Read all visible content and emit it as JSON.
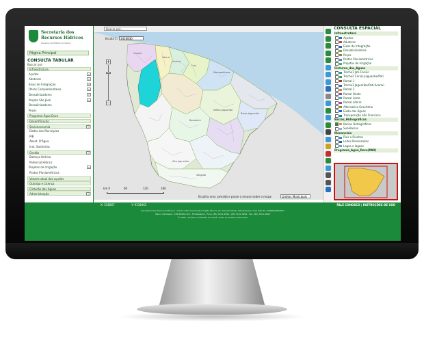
{
  "brand": {
    "line1": "Secretaria dos",
    "line2": "Recursos Hídricos",
    "line3": "Governo do Estado do Ceará"
  },
  "colors": {
    "accent": "#1c8a3b",
    "dark_green": "#124a20",
    "highlight_basin": "#1fd4d8",
    "selected_box": "#cc1111"
  },
  "left_panel": {
    "main_page": "Página Principal",
    "title": "CONSULTA TABULAR",
    "search_label": "Buscar por:",
    "rows": [
      {
        "label": "Infraestrutura",
        "type": "header"
      },
      {
        "label": "Açudes",
        "type": "dropdown"
      },
      {
        "label": "Adutoras",
        "type": "dropdown"
      },
      {
        "label": "Eixos de Integração",
        "type": "dropdown"
      },
      {
        "label": "Obras Complementares",
        "type": "dropdown"
      },
      {
        "label": "Dessalinizadores",
        "type": "dropdown"
      },
      {
        "label": "Projeto São José",
        "type": "dropdown"
      },
      {
        "label": "Dessalinizadores",
        "type": "plain"
      },
      {
        "label": "Poços",
        "type": "plain"
      },
      {
        "label": "Programa Água Doce",
        "type": "header"
      },
      {
        "label": "Desertificação",
        "type": "header"
      },
      {
        "label": "Socioeconomia",
        "type": "header-dd"
      },
      {
        "label": "Dados dos Municípios",
        "type": "sub"
      },
      {
        "label": "PIB",
        "type": "sub"
      },
      {
        "label": "Abast. D'Água",
        "type": "sub"
      },
      {
        "label": "Inst. Sanitárias",
        "type": "sub"
      },
      {
        "label": "Gestão",
        "type": "header-dd"
      },
      {
        "label": "Balanço Hídrico",
        "type": "sub"
      },
      {
        "label": "Potencial Hídrico",
        "type": "sub"
      },
      {
        "label": "Projetos de Irrigação",
        "type": "dropdown"
      },
      {
        "label": "Postos Pluviométricos",
        "type": "sub"
      },
      {
        "label": "Volume atual dos açudes",
        "type": "header"
      },
      {
        "label": "Outorga e Licença",
        "type": "header"
      },
      {
        "label": "Cinturão das Águas",
        "type": "header"
      },
      {
        "label": "Administração",
        "type": "header-dd"
      }
    ]
  },
  "toolbar": {
    "search_placeholder": "Buscar por..."
  },
  "map": {
    "scale_label": "Escala 1:",
    "scale_value": "3426830",
    "scale_bar": [
      "km 0",
      "60",
      "120",
      "180"
    ],
    "hint": "Escolha uma camada e passe o mouse sobre o mapa:",
    "layer_select": "Limites Municipais",
    "region_labels": [
      "Coreaú",
      "Litoral",
      "Acaraú",
      "Curu",
      "Metropolitana",
      "Banabuiú",
      "Médio Jaguaribe",
      "Baixo Jaguaribe",
      "Alto Jaguaribe",
      "Salgado"
    ]
  },
  "right_panel": {
    "title": "CONSULTA ESPACIAL",
    "sections": [
      {
        "title": "Infraestrutura",
        "items": [
          {
            "label": "Açudes",
            "checked": false,
            "swatch": "#2266cc"
          },
          {
            "label": "Adutoras",
            "checked": false,
            "swatch": "#cc4444"
          },
          {
            "label": "Eixos de Integração",
            "checked": false,
            "swatch": "#3355cc"
          },
          {
            "label": "Dessalinizadores",
            "checked": false,
            "swatch": "#66aa44"
          },
          {
            "label": "Poços",
            "checked": false,
            "swatch": "#aa7733"
          },
          {
            "label": "Postos Pluviométricos",
            "checked": false,
            "swatch": "#4488cc"
          },
          {
            "label": "Projetos de Irrigação",
            "checked": false,
            "swatch": "#44aa66"
          }
        ]
      },
      {
        "title": "Cinturao_das_Aguas",
        "items": [
          {
            "label": "Trecho1 Jati-Cariús",
            "checked": false,
            "swatch": "#2299aa"
          },
          {
            "label": "Trecho2 Cariús-Jaguaribe/Poti",
            "checked": false,
            "swatch": "#33aa55"
          },
          {
            "label": "Ramal 1",
            "checked": false,
            "swatch": "#aa3333"
          },
          {
            "label": "Trecho3 Jaguaribe/Poti-Acaraú",
            "checked": false,
            "swatch": "#3366aa"
          },
          {
            "label": "Ramal 2",
            "checked": false,
            "swatch": "#cc8833"
          },
          {
            "label": "Ramal Oeste",
            "checked": false,
            "swatch": "#8844aa"
          },
          {
            "label": "Ramal Leste",
            "checked": false,
            "swatch": "#44aacc"
          },
          {
            "label": "Ramal Litoral",
            "checked": false,
            "swatch": "#aa4488"
          },
          {
            "label": "Alternativa Gravitária",
            "checked": false,
            "swatch": "#888844"
          },
          {
            "label": "Eixão das Águas",
            "checked": false,
            "swatch": "#2266cc"
          },
          {
            "label": "Transposição São Francisco",
            "checked": false,
            "swatch": "#1188bb"
          }
        ]
      },
      {
        "title": "Bacias_Hidrograficas",
        "items": [
          {
            "label": "Bacias Hidrográficas",
            "checked": true,
            "swatch": "#cc9966"
          },
          {
            "label": "Sub-Bacias",
            "checked": false,
            "swatch": "#99aacc"
          }
        ]
      },
      {
        "title": "Mananciais",
        "items": [
          {
            "label": "Rios e Riachos",
            "checked": false,
            "swatch": "#3388dd"
          },
          {
            "label": "Leitos Perenizados",
            "checked": false,
            "swatch": "#2266aa"
          },
          {
            "label": "Lagos e lagoas",
            "checked": false,
            "swatch": "#55aadd"
          }
        ]
      },
      {
        "title": "Programa_Agua_Doce(PAD)",
        "items": []
      }
    ]
  },
  "tools": [
    "zoom-in-icon",
    "pan-left-icon",
    "pan-right-icon",
    "arrow-up-icon",
    "arrow-down-icon",
    "full-extent-icon",
    "zoom-out-icon",
    "identify-icon",
    "info-icon",
    "measure-icon",
    "move-icon",
    "refresh-icon",
    "select-icon",
    "layers-icon",
    "table-icon",
    "draw-icon",
    "pencil-icon",
    "flag-icon",
    "buffer-icon",
    "globe-icon",
    "print-icon",
    "print-alt-icon",
    "help-icon"
  ],
  "status": {
    "x": "X:  538267",
    "y": "Y:  9134061",
    "links": "FALE CONOSCO  |  INSTRUÇÕES DE USO"
  },
  "footer": {
    "line1": "Secretaria dos Recursos Hídricos - Centro Adm Governador Virgílio Távora, Av. General Afonso Albuquerque Lima, S/N, Ed. SCIDE/ASDE/SRH",
    "line2": "Bairro Cambeba - CEP 60822-325 - Fortaleza/Ce - Fone: (85) 3101.3994 | (85) 3101.3994 - Fax: (85) 3101.4048",
    "line3": "© 2009 - Governo do Estado do Ceará. Todos os direitos reservados"
  }
}
